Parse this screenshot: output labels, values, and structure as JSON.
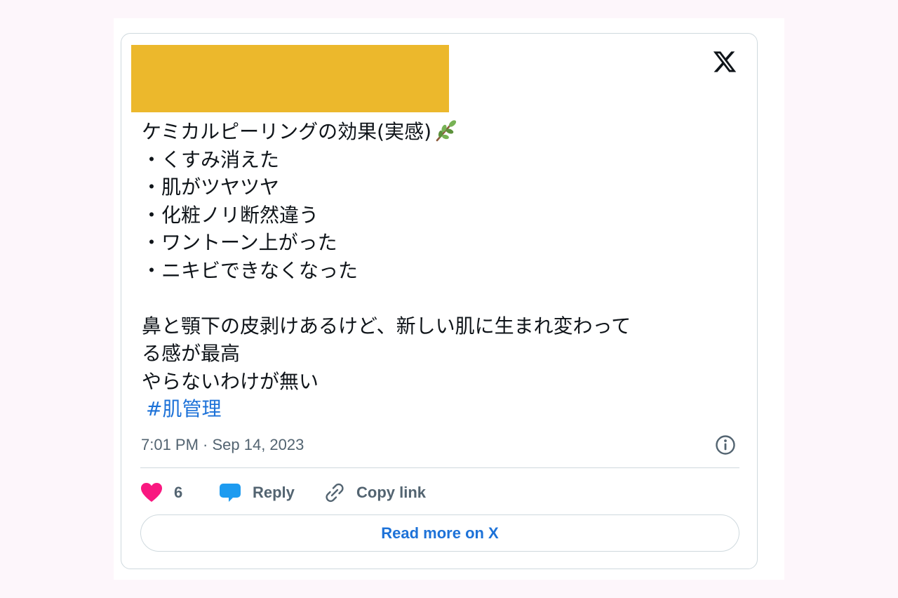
{
  "colors": {
    "redaction": "#ecb82c",
    "link": "#1d72d8",
    "like": "#f91880",
    "reply": "#1d9bf0",
    "muted": "#536471"
  },
  "brand": {
    "icon": "x-logo-icon"
  },
  "tweet": {
    "lines": [
      "ケミカルピーリングの効果(実感)",
      "・くすみ消えた",
      "・肌がツヤツヤ",
      "・化粧ノリ断然違う",
      "・ワントーン上がった",
      "・ニキビできなくなった",
      "",
      "鼻と顎下の皮剥けあるけど、新しい肌に生まれ変わって",
      "る感が最高",
      "やらないわけが無い"
    ],
    "emoji": "herb-branch-icon",
    "hashtag": "#肌管理",
    "timestamp": "7:01 PM · Sep 14, 2023"
  },
  "actions": {
    "like_count": "6",
    "reply_label": "Reply",
    "copy_label": "Copy link"
  },
  "read_more_label": "Read more on X"
}
